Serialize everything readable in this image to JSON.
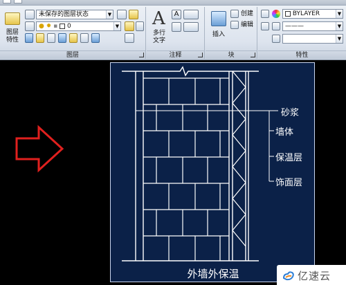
{
  "ribbon": {
    "layers_panel": {
      "title": "图层",
      "layer_properties_label": "图层\n特性",
      "layer_state_combo": "未保存的图层状态",
      "layer_combo": "0"
    },
    "annotation_panel": {
      "title": "注释",
      "mtext_label": "多行\n文字"
    },
    "block_panel": {
      "title": "块",
      "insert_label": "插入",
      "create_label": "创建",
      "edit_label": "编辑"
    },
    "properties_panel": {
      "title": "特性",
      "color_combo": "BYLAYER",
      "linetype_combo": "———"
    }
  },
  "drawing": {
    "callouts": [
      "砂浆",
      "墙体",
      "保温层",
      "饰面层"
    ],
    "caption": "外墙外保温"
  },
  "watermark": {
    "text": "亿速云"
  },
  "colors": {
    "canvas_bg": "#000000",
    "drawing_bg": "#0b2148",
    "drawing_lines": "#ffffff",
    "arrow": "#e0201e"
  }
}
